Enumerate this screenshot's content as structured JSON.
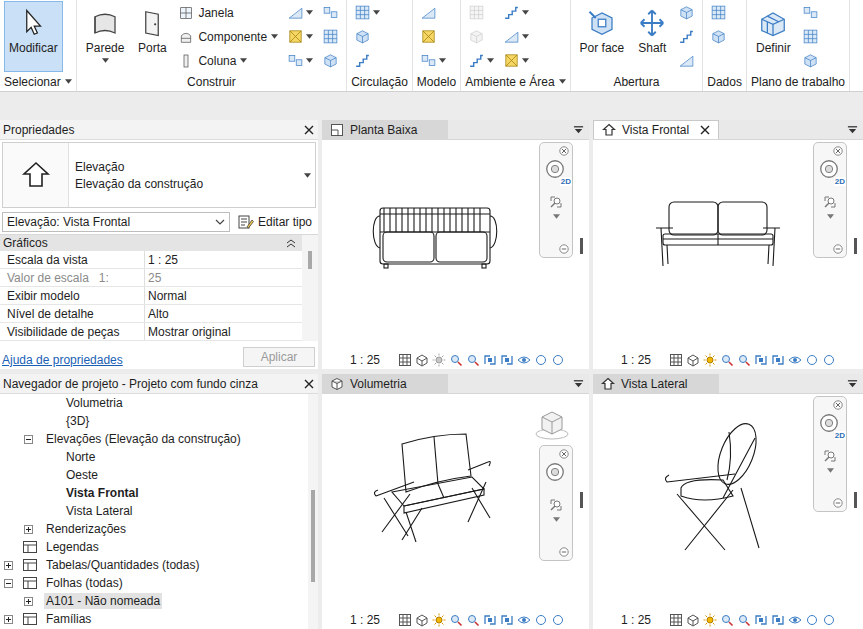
{
  "ribbon": {
    "groups": [
      {
        "label": "Selecionar",
        "dropdown": true,
        "columns": [
          [
            {
              "kind": "large",
              "label": "Modificar",
              "selected": true,
              "dropdown": false,
              "disabled": false
            }
          ]
        ]
      },
      {
        "label": "Construir",
        "dropdown": false,
        "columns": [
          [
            {
              "kind": "large",
              "label": "Parede",
              "selected": false,
              "dropdown": true,
              "disabled": false
            }
          ],
          [
            {
              "kind": "large",
              "label": "Porta",
              "selected": false,
              "dropdown": false,
              "disabled": false
            }
          ],
          [
            {
              "kind": "small",
              "label": "Janela",
              "selected": false,
              "dropdown": false,
              "disabled": false
            },
            {
              "kind": "small",
              "label": "Componente",
              "selected": false,
              "dropdown": true,
              "disabled": false
            },
            {
              "kind": "small",
              "label": "Coluna",
              "selected": false,
              "dropdown": true,
              "disabled": false
            }
          ],
          [
            {
              "kind": "icon",
              "selected": false,
              "dropdown": true,
              "disabled": false
            },
            {
              "kind": "icon",
              "selected": false,
              "dropdown": true,
              "disabled": false
            },
            {
              "kind": "icon",
              "selected": false,
              "dropdown": true,
              "disabled": false
            }
          ],
          [
            {
              "kind": "icon",
              "selected": false,
              "dropdown": false,
              "disabled": false
            },
            {
              "kind": "icon",
              "selected": false,
              "dropdown": false,
              "disabled": false
            },
            {
              "kind": "icon",
              "selected": false,
              "dropdown": false,
              "disabled": false
            }
          ]
        ]
      },
      {
        "label": "Circulação",
        "dropdown": false,
        "columns": [
          [
            {
              "kind": "icon",
              "selected": false,
              "dropdown": true,
              "disabled": false
            },
            {
              "kind": "icon",
              "selected": false,
              "dropdown": false,
              "disabled": false
            },
            {
              "kind": "icon",
              "selected": false,
              "dropdown": false,
              "disabled": false
            }
          ]
        ]
      },
      {
        "label": "Modelo",
        "dropdown": false,
        "columns": [
          [
            {
              "kind": "icon",
              "selected": false,
              "dropdown": false,
              "disabled": false
            },
            {
              "kind": "icon",
              "selected": false,
              "dropdown": false,
              "disabled": false
            },
            {
              "kind": "icon",
              "selected": false,
              "dropdown": true,
              "disabled": false
            }
          ]
        ]
      },
      {
        "label": "Ambiente e Área",
        "dropdown": true,
        "columns": [
          [
            {
              "kind": "icon",
              "selected": false,
              "dropdown": false,
              "disabled": true
            },
            {
              "kind": "icon",
              "selected": false,
              "dropdown": false,
              "disabled": true
            },
            {
              "kind": "icon",
              "selected": false,
              "dropdown": true,
              "disabled": false
            }
          ],
          [
            {
              "kind": "icon",
              "selected": false,
              "dropdown": true,
              "disabled": false
            },
            {
              "kind": "icon",
              "selected": false,
              "dropdown": true,
              "disabled": false
            },
            {
              "kind": "icon",
              "selected": false,
              "dropdown": true,
              "disabled": false
            }
          ]
        ]
      },
      {
        "label": "Abertura",
        "dropdown": false,
        "columns": [
          [
            {
              "kind": "large",
              "label": "Por face",
              "selected": false,
              "dropdown": false,
              "disabled": false
            }
          ],
          [
            {
              "kind": "large",
              "label": "Shaft",
              "selected": false,
              "dropdown": false,
              "disabled": false
            }
          ],
          [
            {
              "kind": "icon",
              "selected": false,
              "dropdown": false,
              "disabled": false
            },
            {
              "kind": "icon",
              "selected": false,
              "dropdown": false,
              "disabled": false
            },
            {
              "kind": "icon",
              "selected": false,
              "dropdown": false,
              "disabled": false
            }
          ]
        ]
      },
      {
        "label": "Dados",
        "dropdown": false,
        "columns": [
          [
            {
              "kind": "icon",
              "selected": false,
              "dropdown": false,
              "disabled": false
            },
            {
              "kind": "icon",
              "selected": false,
              "dropdown": false,
              "disabled": false
            }
          ]
        ]
      },
      {
        "label": "Plano de trabalho",
        "dropdown": false,
        "columns": [
          [
            {
              "kind": "large",
              "label": "Definir",
              "selected": false,
              "dropdown": false,
              "disabled": false
            }
          ],
          [
            {
              "kind": "icon",
              "selected": false,
              "dropdown": false,
              "disabled": false
            },
            {
              "kind": "icon",
              "selected": false,
              "dropdown": false,
              "disabled": false
            },
            {
              "kind": "icon",
              "selected": false,
              "dropdown": false,
              "disabled": false
            }
          ]
        ]
      }
    ]
  },
  "properties": {
    "title": "Propriedades",
    "type_name": "Elevação",
    "type_family": "Elevação da construção",
    "instance_selector": "Elevação: Vista Frontal",
    "edit_type": "Editar tipo",
    "section": "Gráficos",
    "section_expanded": true,
    "rows": [
      {
        "name": "Escala da vista",
        "unit": "",
        "value": "1 : 25",
        "disabled": false
      },
      {
        "name": "Valor de escala",
        "unit": "1:",
        "value": "25",
        "disabled": true
      },
      {
        "name": "Exibir modelo",
        "unit": "",
        "value": "Normal",
        "disabled": false
      },
      {
        "name": "Nível de detalhe",
        "unit": "",
        "value": "Alto",
        "disabled": false
      },
      {
        "name": "Visibilidade de peças",
        "unit": "",
        "value": "Mostrar original",
        "disabled": false
      }
    ],
    "help_link": "Ajuda de propriedades",
    "apply": {
      "label": "Aplicar",
      "disabled": true
    }
  },
  "browser": {
    "title": "Navegador de projeto - Projeto com fundo cinza",
    "items": [
      {
        "label": "Volumetria",
        "level": 2,
        "kind": "node",
        "expander": "none",
        "bold": false,
        "selected": false
      },
      {
        "label": "{3D}",
        "level": 2,
        "kind": "node",
        "expander": "none",
        "bold": false,
        "selected": false
      },
      {
        "label": "Elevações (Elevação da construção)",
        "level": 1,
        "kind": "node",
        "expander": "minus",
        "bold": false,
        "selected": false
      },
      {
        "label": "Norte",
        "level": 2,
        "kind": "node",
        "expander": "none",
        "bold": false,
        "selected": false
      },
      {
        "label": "Oeste",
        "level": 2,
        "kind": "node",
        "expander": "none",
        "bold": false,
        "selected": false
      },
      {
        "label": "Vista Frontal",
        "level": 2,
        "kind": "node",
        "expander": "none",
        "bold": true,
        "selected": false
      },
      {
        "label": "Vista Lateral",
        "level": 2,
        "kind": "node",
        "expander": "none",
        "bold": false,
        "selected": false
      },
      {
        "label": "Renderizações",
        "level": 1,
        "kind": "node",
        "expander": "plus",
        "bold": false,
        "selected": false
      },
      {
        "label": "Legendas",
        "level": 0,
        "kind": "category",
        "expander": "none",
        "bold": false,
        "selected": false
      },
      {
        "label": "Tabelas/Quantidades (todas)",
        "level": 0,
        "kind": "category",
        "expander": "plus",
        "bold": false,
        "selected": false
      },
      {
        "label": "Folhas (todas)",
        "level": 0,
        "kind": "category",
        "expander": "minus",
        "bold": false,
        "selected": false
      },
      {
        "label": "A101 - Não nomeada",
        "level": 1,
        "kind": "node",
        "expander": "plus",
        "bold": false,
        "selected": true
      },
      {
        "label": "Famílias",
        "level": 0,
        "kind": "category",
        "expander": "plus",
        "bold": false,
        "selected": false
      }
    ]
  },
  "nav_badge": "2D",
  "views": [
    {
      "title": "Planta Baixa",
      "kind": "plan",
      "active": false,
      "closable": false,
      "two_d": true,
      "sun_path": false,
      "scale": "1 : 25"
    },
    {
      "title": "Vista Frontal",
      "kind": "front",
      "active": true,
      "closable": true,
      "two_d": true,
      "sun_path": true,
      "scale": "1 : 25"
    },
    {
      "title": "Volumetria",
      "kind": "3d",
      "active": false,
      "closable": false,
      "two_d": false,
      "sun_path": true,
      "scale": "1 : 25"
    },
    {
      "title": "Vista Lateral",
      "kind": "side",
      "active": false,
      "closable": false,
      "two_d": true,
      "sun_path": true,
      "scale": "1 : 25"
    }
  ]
}
